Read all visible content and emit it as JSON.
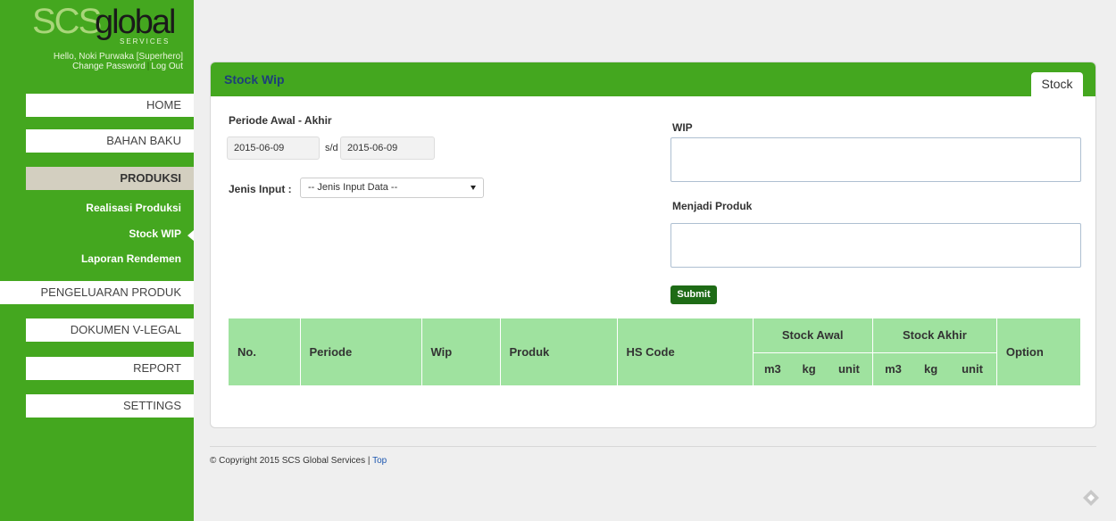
{
  "brand": {
    "part1": "SCS",
    "part2": "global",
    "part3": "SERVICES"
  },
  "user": {
    "greeting": "Hello, Noki Purwaka [Superhero]",
    "change_password": "Change Password",
    "logout": "Log Out"
  },
  "nav": {
    "home": "HOME",
    "bahan_baku": "BAHAN BAKU",
    "produksi": "PRODUKSI",
    "sub": {
      "realisasi": "Realisasi Produksi",
      "stock_wip": "Stock WIP",
      "laporan": "Laporan Rendemen"
    },
    "pengeluaran": "PENGELUARAN PRODUK",
    "dokumen": "DOKUMEN V-LEGAL",
    "report": "REPORT",
    "settings": "SETTINGS"
  },
  "panel": {
    "title": "Stock Wip",
    "tab": "Stock"
  },
  "form": {
    "periode_label": "Periode Awal - Akhir",
    "date_start": "2015-06-09",
    "sd": "s/d",
    "date_end": "2015-06-09",
    "jenis_label": "Jenis Input :",
    "jenis_value": "-- Jenis Input Data --",
    "wip_label": "WIP",
    "menjadi_label": "Menjadi Produk",
    "submit": "Submit"
  },
  "table": {
    "headers": {
      "no": "No.",
      "periode": "Periode",
      "wip": "Wip",
      "produk": "Produk",
      "hs_code": "HS Code",
      "stock_awal": "Stock Awal",
      "stock_akhir": "Stock Akhir",
      "option": "Option"
    },
    "units": {
      "m3": "m3",
      "kg": "kg",
      "unit": "unit"
    }
  },
  "footer": {
    "copyright": "© Copyright 2015 SCS Global Services | ",
    "top": "Top"
  },
  "colors": {
    "sidebar_green": "#44a71f",
    "table_header": "#9fe29f",
    "submit_green": "#1e6b16",
    "title_blue": "#1d3f7a"
  }
}
